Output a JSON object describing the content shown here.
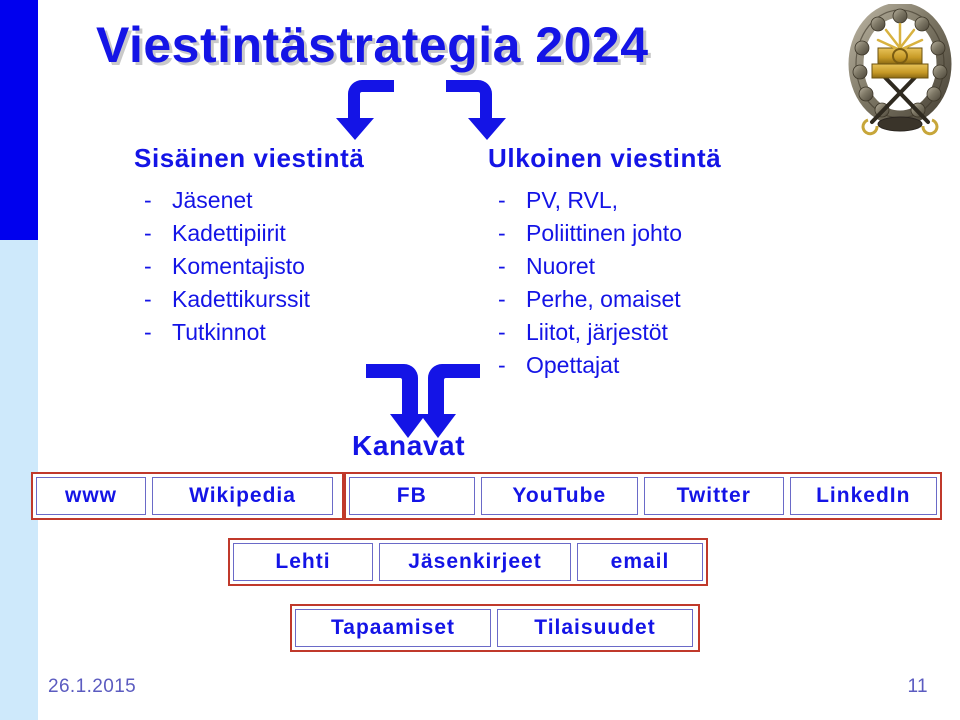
{
  "slide": {
    "title": "Viestintästrategia 2024",
    "emblem_name": "cadet-association-badge"
  },
  "internal": {
    "heading": "Sisäinen viestintä",
    "bullet_marker": "-",
    "items": [
      "Jäsenet",
      "Kadettipiirit",
      "Komentajisto",
      "Kadettikurssit",
      "Tutkinnot"
    ]
  },
  "external": {
    "heading": "Ulkoinen viestintä",
    "bullet_marker": "-",
    "items": [
      "PV, RVL,",
      "Poliittinen johto",
      "Nuoret",
      "Perhe, omaiset",
      "Liitot, järjestöt",
      "Opettajat"
    ]
  },
  "channels": {
    "label": "Kanavat",
    "groups": [
      {
        "name": "web",
        "chips": [
          "www",
          "Wikipedia"
        ]
      },
      {
        "name": "social",
        "chips": [
          "FB",
          "YouTube",
          "Twitter",
          "LinkedIn"
        ]
      },
      {
        "name": "print",
        "chips": [
          "Lehti",
          "Jäsenkirjeet",
          "email"
        ]
      },
      {
        "name": "events",
        "chips": [
          "Tapaamiset",
          "Tilaisuudet"
        ]
      }
    ]
  },
  "footer": {
    "date": "26.1.2015",
    "page_number": "11"
  },
  "colors": {
    "primary_blue": "#1414e6",
    "bar_blue": "#0000ee",
    "bar_light_blue": "#cee9fb",
    "box_red": "#c0392b",
    "chip_border": "#6a6ac8",
    "footer_text": "#5b5bc0",
    "title_shadow": "#c9c9c9"
  }
}
